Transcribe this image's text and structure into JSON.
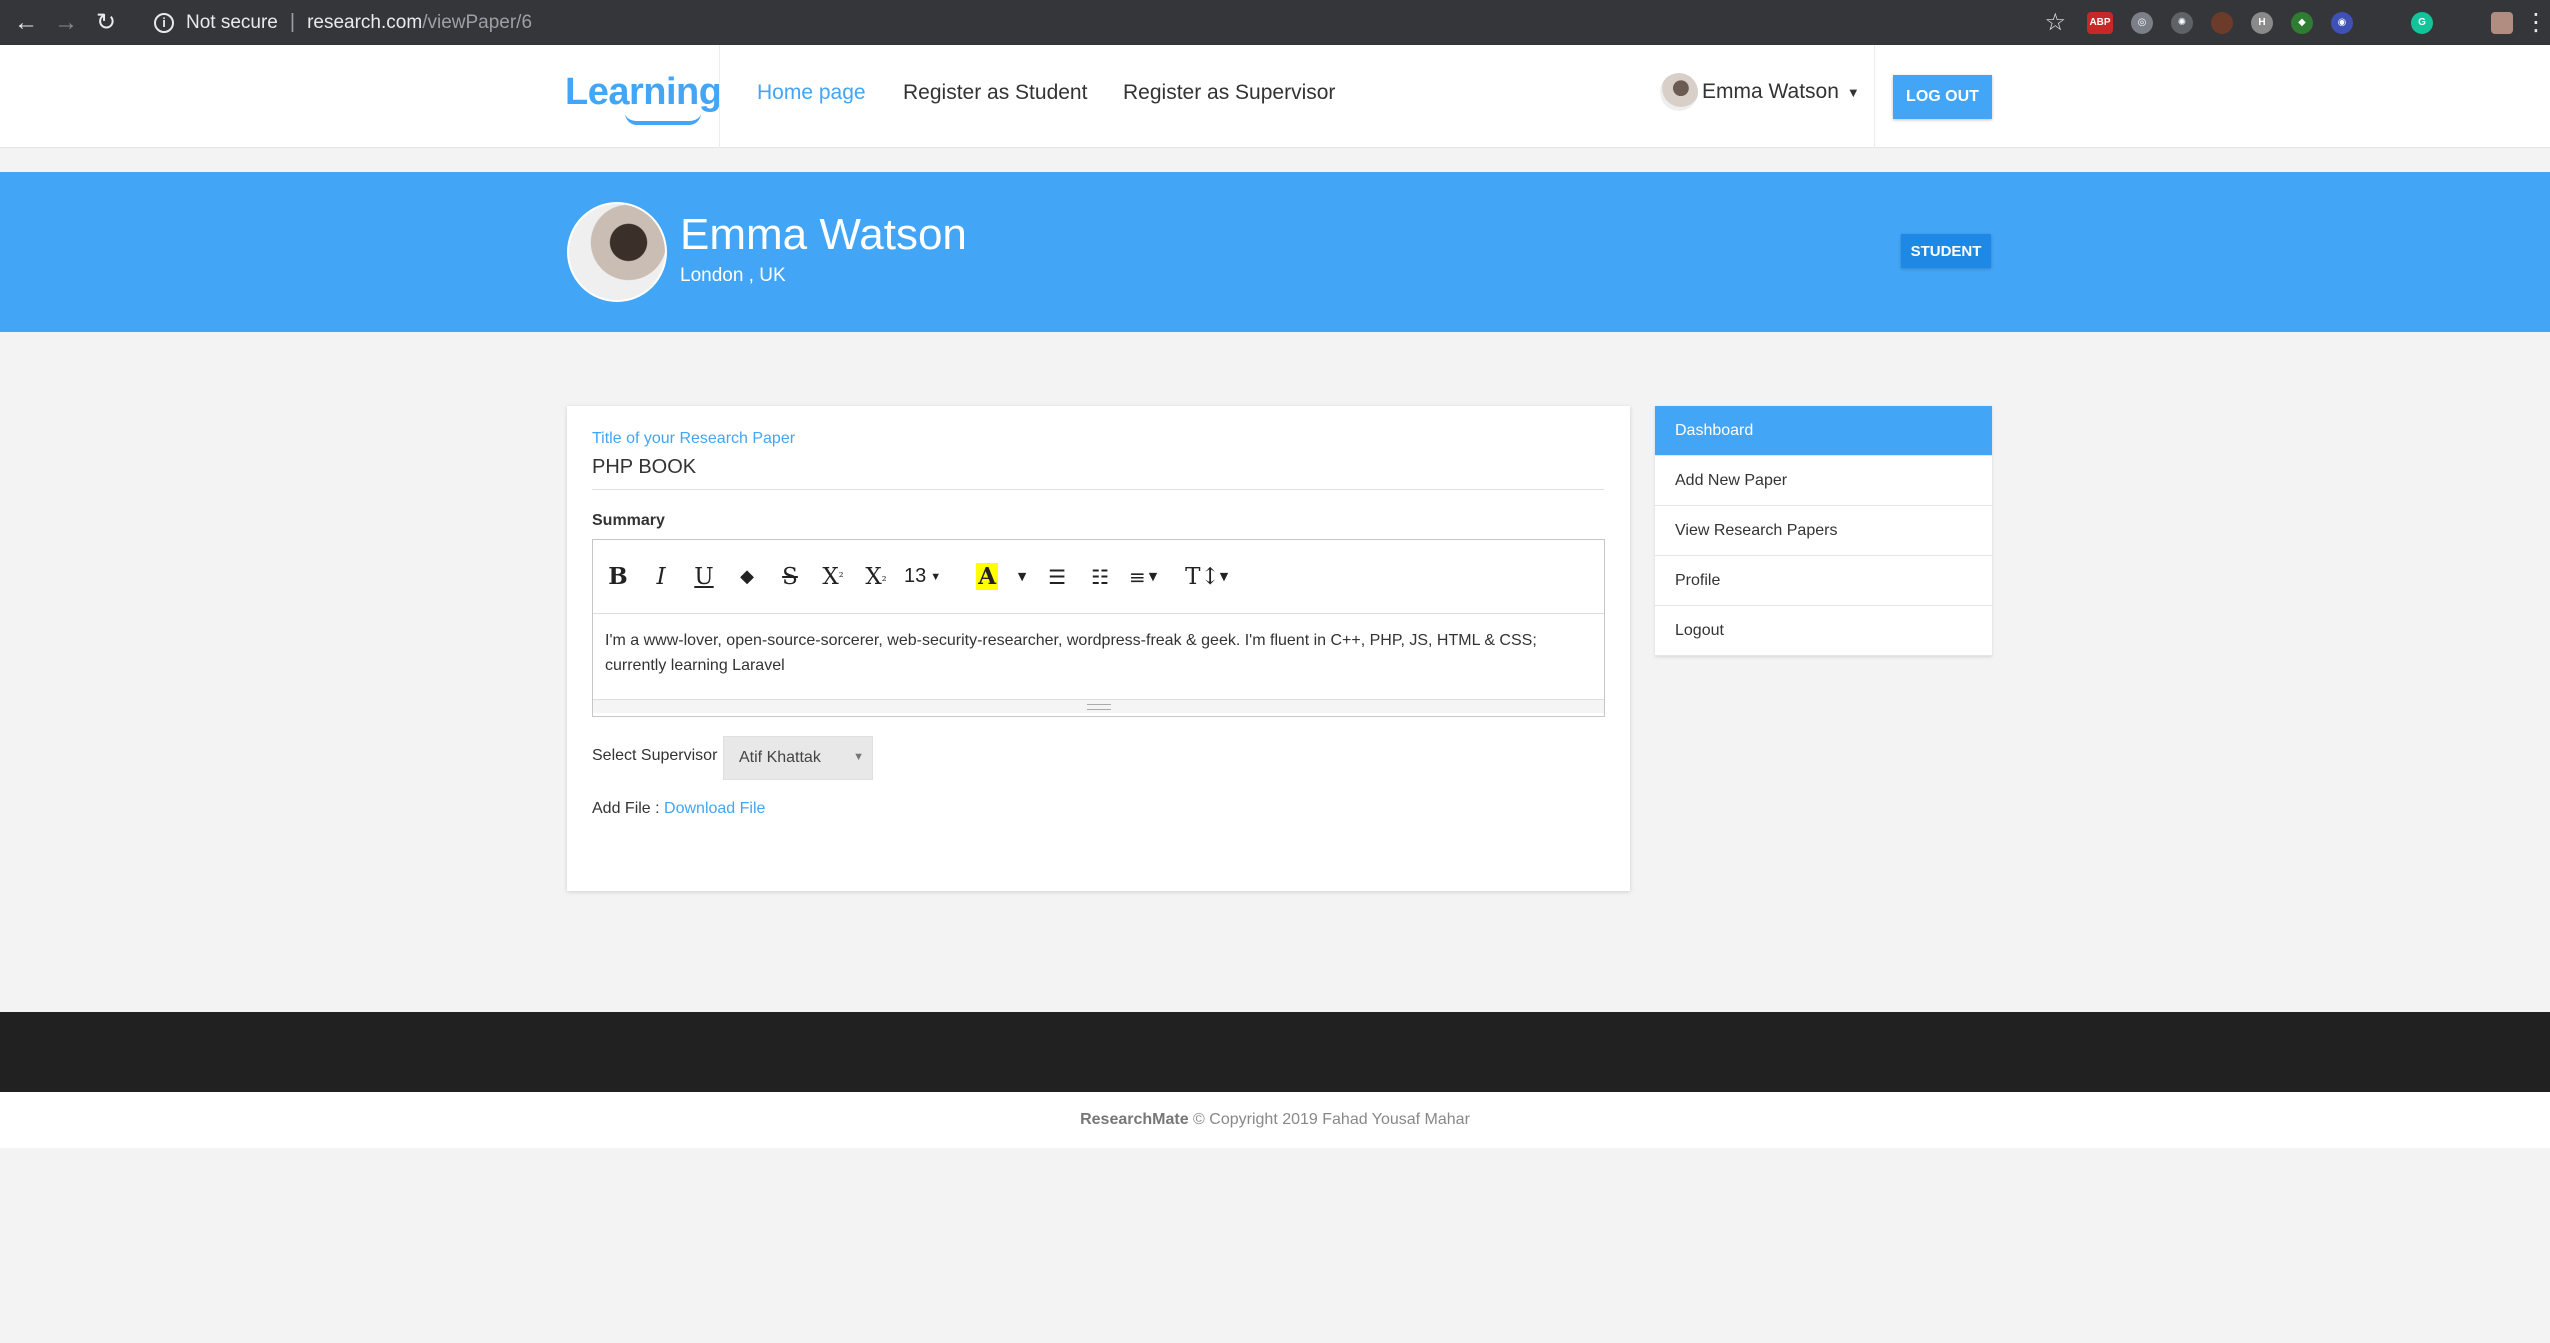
{
  "browser": {
    "security_label": "Not secure",
    "url_host": "research.com",
    "url_path": "/viewPaper/6",
    "extensions": [
      {
        "name": "adblock-icon",
        "label": "ABP",
        "color": "#c62828"
      },
      {
        "name": "extension-icon",
        "label": "",
        "color": "#7a7f88"
      },
      {
        "name": "extension-icon",
        "label": "",
        "color": "#5f6368"
      },
      {
        "name": "extension-icon",
        "label": "",
        "color": "#6d3b2a"
      },
      {
        "name": "extension-icon",
        "label": "H",
        "color": "#8a8a8a"
      },
      {
        "name": "extension-icon",
        "label": "",
        "color": "#2e7d32"
      },
      {
        "name": "extension-icon",
        "label": "",
        "color": "#3f51b5"
      },
      {
        "name": "grammarly-icon",
        "label": "G",
        "color": "#15c39a"
      }
    ]
  },
  "nav": {
    "logo": "Learning",
    "links": [
      "Home page",
      "Register as Student",
      "Register as Supervisor"
    ],
    "user_name": "Emma Watson",
    "logout_label": "LOG OUT"
  },
  "hero": {
    "name": "Emma Watson",
    "location": "London , UK",
    "role_badge": "STUDENT"
  },
  "form": {
    "title_label": "Title of your Research Paper",
    "title_value": "PHP BOOK",
    "summary_label": "Summary",
    "font_size": "13",
    "summary_text": "I'm a www-lover, open-source-sorcerer, web-security-researcher, wordpress-freak & geek. I'm fluent in C++, PHP, JS, HTML & CSS; currently learning Laravel",
    "supervisor_label": "Select Supervisor",
    "supervisor_value": "Atif Khattak",
    "file_label": "Add File :",
    "file_link": "Download File"
  },
  "sidebar": {
    "items": [
      "Dashboard",
      "Add New Paper",
      "View Research Papers",
      "Profile",
      "Logout"
    ]
  },
  "footer": {
    "brand": "ResearchMate",
    "copyright": "© Copyright 2019 Fahad Yousaf Mahar"
  },
  "colors": {
    "accent": "#42a5f5",
    "footer_dark": "#212121"
  }
}
